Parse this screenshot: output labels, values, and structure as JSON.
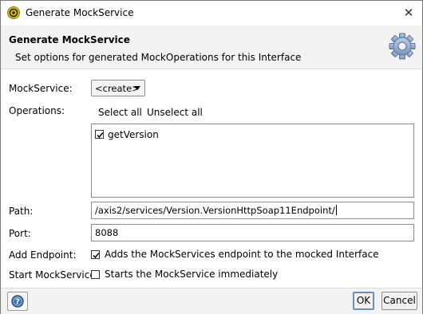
{
  "window": {
    "title": "Generate MockService",
    "close_glyph": "✕"
  },
  "header": {
    "title": "Generate MockService",
    "subtitle": "Set options for generated MockOperations for this Interface",
    "icon": "gear-icon"
  },
  "form": {
    "mockservice": {
      "label": "MockService:",
      "selected": "<create>"
    },
    "operations": {
      "label": "Operations:",
      "select_all": "Select all",
      "unselect_all": "Unselect all",
      "items": [
        {
          "label": "getVersion",
          "checked": true
        }
      ]
    },
    "path": {
      "label": "Path:",
      "value": "/axis2/services/Version.VersionHttpSoap11Endpoint/"
    },
    "port": {
      "label": "Port:",
      "value": "8088"
    },
    "add_endpoint": {
      "label": "Add Endpoint:",
      "text": "Adds the MockServices endpoint to the mocked Interface",
      "checked": true
    },
    "start_mockservice": {
      "label": "Start MockService:",
      "text": "Starts the MockService immediately",
      "checked": false
    }
  },
  "footer": {
    "help_icon": "help-icon",
    "ok_label": "OK",
    "cancel_label": "Cancel"
  }
}
